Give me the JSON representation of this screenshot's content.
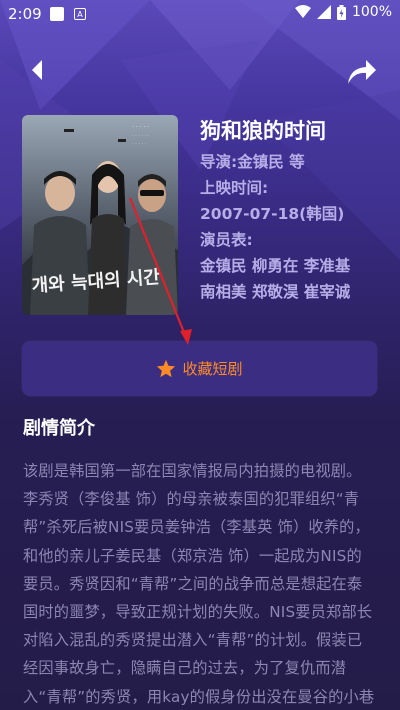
{
  "status_bar": {
    "time": "2:09",
    "battery": "100%"
  },
  "nav": {
    "back_icon": "chevron-left-icon",
    "share_icon": "share-arrow-icon"
  },
  "drama": {
    "title": "狗和狼的时间",
    "director": "导演:金镇民 等",
    "release_label": "上映时间:",
    "release_date": "2007-07-18(韩国)",
    "cast_label": "演员表:",
    "cast_line1": "金镇民 柳勇在 李准基",
    "cast_line2": "南相美 郑敬淏 崔宰诚"
  },
  "poster": {
    "title_text": "개와 늑대의 시간"
  },
  "collect": {
    "label": "收藏短剧",
    "icon": "star-icon",
    "icon_color": "#ff8a26"
  },
  "synopsis": {
    "heading": "剧情简介",
    "text": "该剧是韩国第一部在国家情报局内拍摄的电视剧。 李秀贤（李俊基 饰）的母亲被泰国的犯罪组织“青帮”杀死后被NIS要员姜钟浩（李基英 饰）收养的，和他的亲儿子姜民基（郑京浩 饰）一起成为NIS的要员。秀贤因和“青帮”之间的战争而总是想起在泰国时的噩梦，导致正规计划的失败。NIS要员郑部长对陷入混乱的秀贤提出潜入“青帮”的计划。假装已经因事故身亡，隐瞒自己的过去，为了复仇而潜入“青帮”的秀贤，用kay的假身份出没在曼谷的小巷子、阴暗的角落里，成了NIS的敌原要员，秀贤的敌原身份也被"
  },
  "colors": {
    "accent": "#ff8a26",
    "annotation_arrow": "#e0202a"
  }
}
